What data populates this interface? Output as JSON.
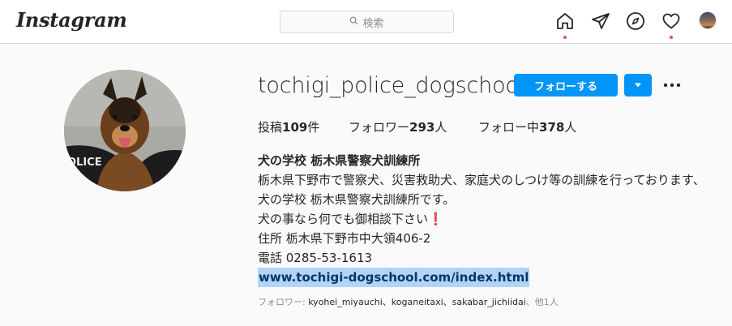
{
  "header": {
    "logo": "Instagram",
    "search_placeholder": "検索",
    "icons": [
      "home-icon",
      "direct-icon",
      "explore-icon",
      "activity-icon",
      "profile-avatar"
    ]
  },
  "profile": {
    "username": "tochigi_police_dogschool",
    "follow_label": "フォローする",
    "stats": {
      "posts_label": "投稿",
      "posts_count": "109",
      "posts_unit": "件",
      "followers_label": "フォロワー",
      "followers_count": "293",
      "followers_unit": "人",
      "following_label": "フォロー中",
      "following_count": "378",
      "following_unit": "人"
    },
    "bio": {
      "name": "犬の学校 栃木県警察犬訓練所",
      "lines": [
        "栃木県下野市で警察犬、災害救助犬、家庭犬のしつけ等の訓練を行っております、",
        "犬の学校 栃木県警察犬訓練所です。",
        "犬の事なら何でも御相談下さい",
        "住所 栃木県下野市中大領406-2",
        "電話 0285-53-1613"
      ],
      "exclaim": "❗",
      "link": "www.tochigi-dogschool.com/index.html"
    },
    "followed_by": {
      "label": "フォロワー: ",
      "names": "kyohei_miyauchi、koganeitaxi、sakabar_jichiidai",
      "more": "、他1人"
    }
  },
  "colors": {
    "accent": "#0095f6",
    "notification_dot": "#ed4956",
    "link": "#00376b",
    "link_highlight": "#b3d4f5"
  }
}
